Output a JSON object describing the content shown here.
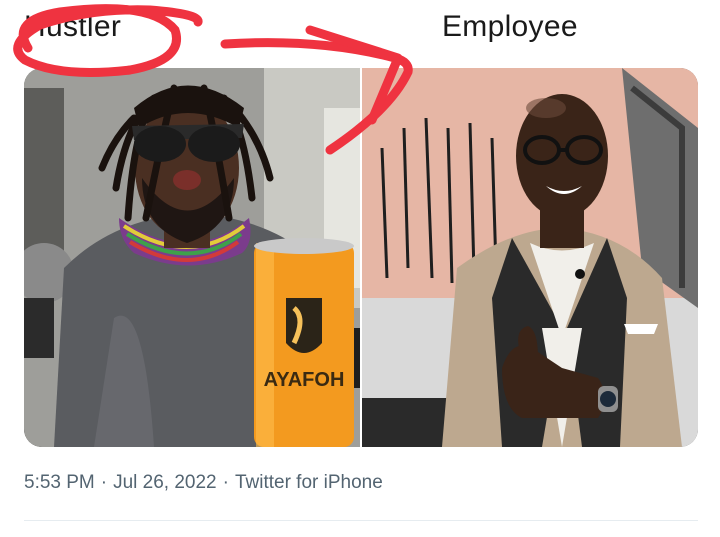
{
  "captions": {
    "left": "Hustler",
    "right": "Employee"
  },
  "can_label": "AYAFOH",
  "tweet_meta": {
    "time": "5:53 PM",
    "date": "Jul 26, 2022",
    "source": "Twitter for iPhone",
    "separator": "·"
  },
  "colors": {
    "annotation_red": "#ef3340",
    "meta_gray": "#536471",
    "can_orange": "#f39a1f"
  }
}
